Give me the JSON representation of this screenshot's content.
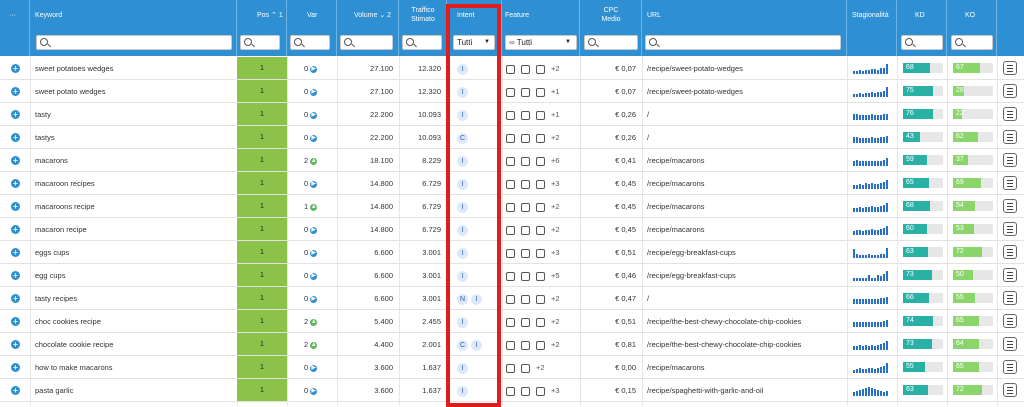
{
  "header": {
    "menu": "···",
    "keyword": "Keyword",
    "pos": "Pos",
    "pos_sort": "1",
    "var": "Var",
    "volume": "Volume",
    "volume_sort": "2",
    "traffic_line1": "Traffico",
    "traffic_line2": "Stimato",
    "intent": "Intent",
    "feature": "Feature",
    "cpc_line1": "CPC",
    "cpc_line2": "Medio",
    "url": "URL",
    "season": "Stagionalità",
    "kd": "KD",
    "ko": "KO",
    "intent_select": "Tutti",
    "feature_select": "Tutti"
  },
  "colors": {
    "header": "#2e8fd3",
    "pos_bg": "#8bc34a",
    "kd": "#2ab1a6",
    "ko": "#8bd66a",
    "highlight": "#e21b1b"
  },
  "rows": [
    {
      "keyword": "sweet potatoes wedges",
      "pos": "1",
      "var": "0",
      "var_dir": "right",
      "volume": "27.100",
      "traffic": "12.320",
      "intent": [
        "I"
      ],
      "features": [
        "ico",
        "ico",
        "ico"
      ],
      "more": "+2",
      "cpc": "€ 0,07",
      "url": "/recipe/sweet-potato-wedges",
      "kd": "68",
      "ko": "67",
      "kd_fill": 0.68,
      "ko_fill": 0.67,
      "season": [
        3,
        3,
        4,
        3,
        4,
        4,
        5,
        5,
        4,
        6,
        6,
        10
      ]
    },
    {
      "keyword": "sweet potato wedges",
      "pos": "1",
      "var": "0",
      "var_dir": "right",
      "volume": "27.100",
      "traffic": "12.320",
      "intent": [
        "I"
      ],
      "features": [
        "ico",
        "ico",
        "ico"
      ],
      "more": "+1",
      "cpc": "€ 0,07",
      "url": "/recipe/sweet-potato-wedges",
      "kd": "75",
      "ko": "28",
      "kd_fill": 0.75,
      "ko_fill": 0.28,
      "season": [
        3,
        3,
        4,
        3,
        4,
        4,
        5,
        4,
        5,
        5,
        6,
        10
      ]
    },
    {
      "keyword": "tasty",
      "pos": "1",
      "var": "0",
      "var_dir": "right",
      "volume": "22.200",
      "traffic": "10.093",
      "intent": [
        "I"
      ],
      "features": [
        "ico",
        "ico",
        "ico"
      ],
      "more": "+1",
      "cpc": "€ 0,26",
      "url": "/",
      "kd": "76",
      "ko": "22",
      "kd_fill": 0.76,
      "ko_fill": 0.22,
      "season": [
        6,
        6,
        5,
        5,
        5,
        5,
        6,
        5,
        5,
        5,
        6,
        6
      ]
    },
    {
      "keyword": "tastys",
      "pos": "1",
      "var": "0",
      "var_dir": "right",
      "volume": "22.200",
      "traffic": "10.093",
      "intent": [
        "C"
      ],
      "features": [
        "ico",
        "ico",
        "ico"
      ],
      "more": "+2",
      "cpc": "€ 0,26",
      "url": "/",
      "kd": "43",
      "ko": "62",
      "kd_fill": 0.43,
      "ko_fill": 0.62,
      "season": [
        6,
        6,
        5,
        5,
        5,
        5,
        6,
        5,
        5,
        6,
        6,
        7
      ]
    },
    {
      "keyword": "macarons",
      "pos": "1",
      "var": "2",
      "var_dir": "up",
      "volume": "18.100",
      "traffic": "8.229",
      "intent": [
        "I"
      ],
      "features": [
        "ico",
        "ico",
        "ico"
      ],
      "more": "+6",
      "cpc": "€ 0,41",
      "url": "/recipe/macarons",
      "kd": "59",
      "ko": "37",
      "kd_fill": 0.59,
      "ko_fill": 0.37,
      "season": [
        5,
        6,
        5,
        5,
        5,
        5,
        5,
        5,
        5,
        5,
        6,
        8
      ]
    },
    {
      "keyword": "macaroon recipes",
      "pos": "1",
      "var": "0",
      "var_dir": "right",
      "volume": "14.800",
      "traffic": "6.729",
      "intent": [
        "I"
      ],
      "features": [
        "ico",
        "ico",
        "ico"
      ],
      "more": "+3",
      "cpc": "€ 0,45",
      "url": "/recipe/macarons",
      "kd": "65",
      "ko": "69",
      "kd_fill": 0.65,
      "ko_fill": 0.69,
      "season": [
        4,
        4,
        5,
        4,
        6,
        5,
        6,
        5,
        5,
        6,
        7,
        9
      ]
    },
    {
      "keyword": "macaroons recipe",
      "pos": "1",
      "var": "1",
      "var_dir": "up",
      "volume": "14.800",
      "traffic": "6.729",
      "intent": [
        "I"
      ],
      "features": [
        "ico",
        "ico",
        "ico"
      ],
      "more": "+2",
      "cpc": "€ 0,45",
      "url": "/recipe/macarons",
      "kd": "68",
      "ko": "54",
      "kd_fill": 0.68,
      "ko_fill": 0.54,
      "season": [
        4,
        4,
        5,
        4,
        5,
        5,
        6,
        5,
        5,
        6,
        7,
        9
      ]
    },
    {
      "keyword": "macaron recipe",
      "pos": "1",
      "var": "0",
      "var_dir": "right",
      "volume": "14.800",
      "traffic": "6.729",
      "intent": [
        "I"
      ],
      "features": [
        "ico",
        "ico",
        "ico"
      ],
      "more": "+2",
      "cpc": "€ 0,45",
      "url": "/recipe/macarons",
      "kd": "60",
      "ko": "53",
      "kd_fill": 0.6,
      "ko_fill": 0.53,
      "season": [
        4,
        5,
        5,
        4,
        5,
        5,
        6,
        5,
        5,
        6,
        7,
        9
      ]
    },
    {
      "keyword": "eggs cups",
      "pos": "1",
      "var": "0",
      "var_dir": "right",
      "volume": "6.600",
      "traffic": "3.001",
      "intent": [
        "I"
      ],
      "features": [
        "ico",
        "ico",
        "ico"
      ],
      "more": "+3",
      "cpc": "€ 0,51",
      "url": "/recipe/egg-breakfast-cups",
      "kd": "63",
      "ko": "72",
      "kd_fill": 0.63,
      "ko_fill": 0.72,
      "season": [
        9,
        4,
        3,
        3,
        3,
        4,
        3,
        3,
        3,
        4,
        4,
        10
      ]
    },
    {
      "keyword": "egg cups",
      "pos": "1",
      "var": "0",
      "var_dir": "right",
      "volume": "6.600",
      "traffic": "3.001",
      "intent": [
        "I"
      ],
      "features": [
        "ico",
        "ico",
        "ico"
      ],
      "more": "+5",
      "cpc": "€ 0,46",
      "url": "/recipe/egg-breakfast-cups",
      "kd": "73",
      "ko": "50",
      "kd_fill": 0.73,
      "ko_fill": 0.5,
      "season": [
        3,
        3,
        3,
        3,
        3,
        6,
        3,
        3,
        6,
        5,
        7,
        10
      ]
    },
    {
      "keyword": "tasty recipes",
      "pos": "1",
      "var": "0",
      "var_dir": "right",
      "volume": "6.600",
      "traffic": "3.001",
      "intent": [
        "N",
        "I"
      ],
      "features": [
        "ico",
        "ico",
        "ico"
      ],
      "more": "+2",
      "cpc": "€ 0,47",
      "url": "/",
      "kd": "66",
      "ko": "55",
      "kd_fill": 0.66,
      "ko_fill": 0.55,
      "season": [
        5,
        5,
        5,
        5,
        5,
        5,
        5,
        5,
        5,
        6,
        6,
        7
      ]
    },
    {
      "keyword": "choc cookies recipe",
      "pos": "1",
      "var": "2",
      "var_dir": "up",
      "volume": "5.400",
      "traffic": "2.455",
      "intent": [
        "I"
      ],
      "features": [
        "ico",
        "ico",
        "ico"
      ],
      "more": "+2",
      "cpc": "€ 0,51",
      "url": "/recipe/the-best-chewy-chocolate-chip-cookies",
      "kd": "74",
      "ko": "65",
      "kd_fill": 0.74,
      "ko_fill": 0.65,
      "season": [
        5,
        5,
        5,
        5,
        5,
        5,
        5,
        5,
        5,
        5,
        6,
        7
      ]
    },
    {
      "keyword": "chocolate cookie recipe",
      "pos": "1",
      "var": "2",
      "var_dir": "up",
      "volume": "4.400",
      "traffic": "2.001",
      "intent": [
        "C",
        "I"
      ],
      "features": [
        "ico",
        "ico",
        "ico"
      ],
      "more": "+2",
      "cpc": "€ 0,81",
      "url": "/recipe/the-best-chewy-chocolate-chip-cookies",
      "kd": "73",
      "ko": "64",
      "kd_fill": 0.73,
      "ko_fill": 0.64,
      "season": [
        4,
        4,
        5,
        4,
        5,
        4,
        5,
        4,
        5,
        6,
        7,
        9
      ]
    },
    {
      "keyword": "how to make macarons",
      "pos": "1",
      "var": "0",
      "var_dir": "right",
      "volume": "3.600",
      "traffic": "1.637",
      "intent": [
        "I"
      ],
      "features": [
        "ico",
        "ico"
      ],
      "more": "+2",
      "cpc": "€ 0,00",
      "url": "/recipe/macarons",
      "kd": "55",
      "ko": "65",
      "kd_fill": 0.55,
      "ko_fill": 0.65,
      "season": [
        3,
        4,
        5,
        4,
        4,
        5,
        5,
        4,
        5,
        6,
        7,
        10
      ]
    },
    {
      "keyword": "pasta garlic",
      "pos": "1",
      "var": "0",
      "var_dir": "right",
      "volume": "3.600",
      "traffic": "1.637",
      "intent": [
        "I"
      ],
      "features": [
        "ico",
        "ico",
        "ico"
      ],
      "more": "+3",
      "cpc": "€ 0,15",
      "url": "/recipe/spaghetti-with-garlic-and-oil",
      "kd": "63",
      "ko": "72",
      "kd_fill": 0.63,
      "ko_fill": 0.72,
      "season": [
        4,
        5,
        6,
        7,
        8,
        9,
        8,
        7,
        6,
        5,
        4,
        5
      ]
    }
  ]
}
